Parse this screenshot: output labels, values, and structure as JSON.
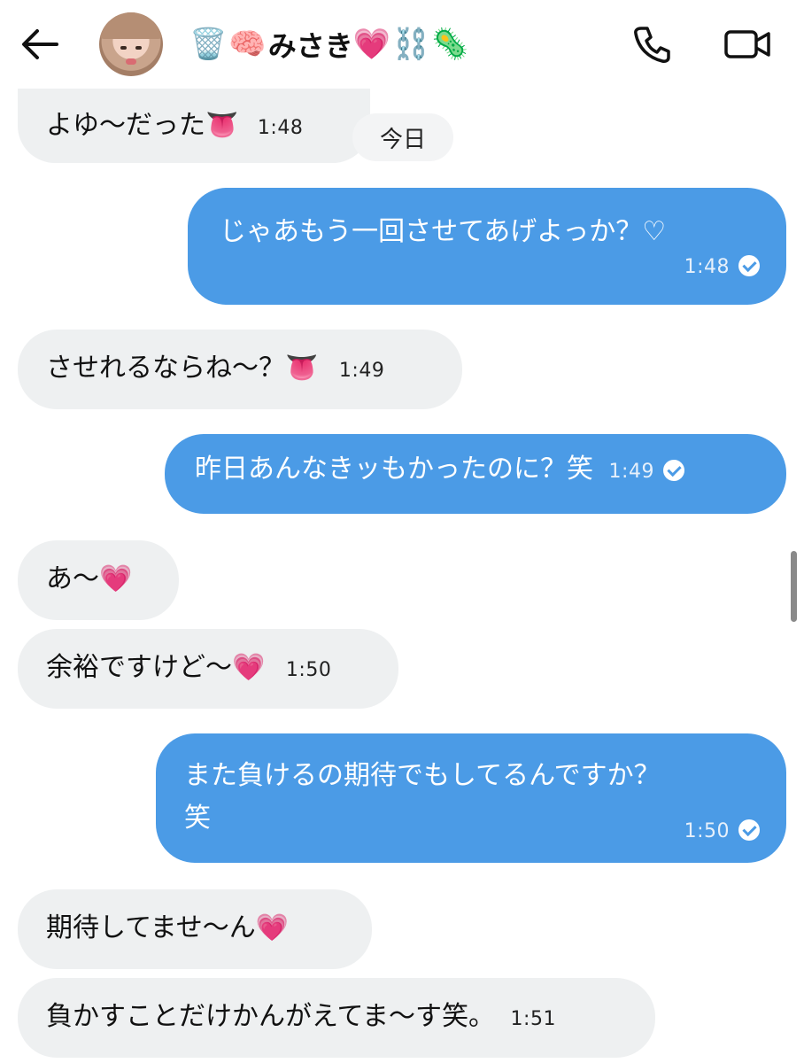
{
  "header": {
    "name_emojis_left": [
      "🗑️",
      "🧠"
    ],
    "name": "みさき",
    "name_emojis_right": [
      "💗",
      "⛓️",
      "🦠"
    ]
  },
  "date_separator": "今日",
  "messages": [
    {
      "side": "in",
      "text": "よゆ～だった",
      "emoji": "👅",
      "time": "1:48"
    },
    {
      "side": "out",
      "text": "じゃあもう一回させてあげよっか？♡",
      "time": "1:48",
      "read": true
    },
    {
      "side": "in",
      "text": "させれるならね～？",
      "emoji": "👅",
      "time": "1:49"
    },
    {
      "side": "out",
      "text": "昨日あんなきッもかったのに？笑",
      "time": "1:49",
      "read": true
    },
    {
      "side": "in",
      "text": "あ～",
      "emoji": "💗"
    },
    {
      "side": "in",
      "text": "余裕ですけど～",
      "emoji": "💗",
      "time": "1:50"
    },
    {
      "side": "out",
      "text_line1": "また負けるの期待でもしてるんですか？",
      "text_line2": "笑",
      "time": "1:50",
      "read": true
    },
    {
      "side": "in",
      "text": "期待してませ～ん",
      "emoji": "💗"
    },
    {
      "side": "in",
      "text": "負かすことだけかんがえてま～す笑。",
      "time": "1:51"
    }
  ],
  "colors": {
    "outgoing_bubble": "#4b9be6",
    "incoming_bubble": "#eef0f1",
    "header_background": "#ffffff"
  },
  "icons": {
    "back": "arrow-left-icon",
    "call": "phone-icon",
    "video": "video-camera-icon",
    "read": "check-circle-icon"
  }
}
